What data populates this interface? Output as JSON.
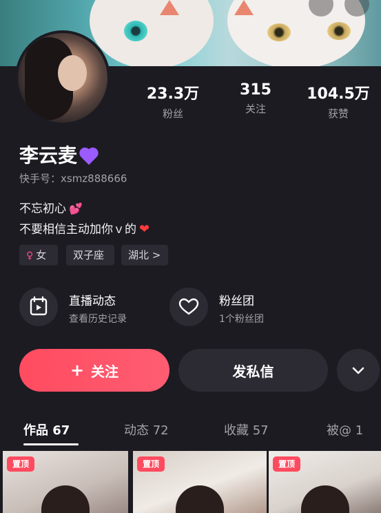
{
  "profile": {
    "name": "李云麦",
    "kuaishou_id": "快手号：xsmz888666",
    "bio_line1": "不忘初心",
    "bio_line2": "不要相信主动加你ｖ的",
    "tags": {
      "gender": "女",
      "zodiac": "双子座",
      "location": "湖北 >"
    }
  },
  "stats": [
    {
      "value": "23.3万",
      "label": "粉丝"
    },
    {
      "value": "315",
      "label": "关注"
    },
    {
      "value": "104.5万",
      "label": "获赞"
    }
  ],
  "features": [
    {
      "title": "直播动态",
      "subtitle": "查看历史记录",
      "icon": "calendar-play-icon"
    },
    {
      "title": "粉丝团",
      "subtitle": "1个粉丝团",
      "icon": "heart-badge-icon"
    }
  ],
  "actions": {
    "follow_plus": "+",
    "follow_label": "关注",
    "message_label": "发私信",
    "more_icon": "chevron-down-icon"
  },
  "tabs": [
    {
      "label": "作品 67"
    },
    {
      "label": "动态 72"
    },
    {
      "label": "收藏 57"
    },
    {
      "label": "被@ 1"
    }
  ],
  "thumbnails": [
    {
      "badge": "置顶"
    },
    {
      "badge": "置顶"
    },
    {
      "badge": "置顶"
    }
  ],
  "colors": {
    "background": "#1c1b22",
    "accent": "#ff4b5f",
    "card": "#2c2b33",
    "muted_text": "#a3a2a8"
  }
}
